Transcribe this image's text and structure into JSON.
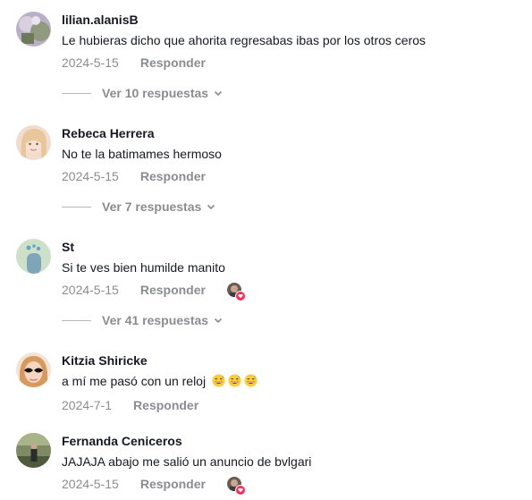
{
  "comments": [
    {
      "username": "lilian.alanisB",
      "text": "Le hubieras dicho que ahorita regresabas ibas por los otros ceros",
      "date": "2024-5-15",
      "reply_label": "Responder",
      "replies_label": "Ver 10 respuestas"
    },
    {
      "username": "Rebeca Herrera",
      "text": "No te la batimames hermoso",
      "date": "2024-5-15",
      "reply_label": "Responder",
      "replies_label": "Ver 7 respuestas"
    },
    {
      "username": "St",
      "text": "Si te ves bien humilde manito",
      "date": "2024-5-15",
      "reply_label": "Responder",
      "replies_label": "Ver 41 respuestas",
      "liked_by_creator": true
    },
    {
      "username": "Kitzia Shiricke",
      "text": "a mí me pasó con un reloj",
      "emojis": [
        "grinning-sweat-emoji",
        "grinning-sweat-emoji",
        "grinning-sweat-emoji"
      ],
      "date": "2024-7-1",
      "reply_label": "Responder"
    },
    {
      "username": "Fernanda Ceniceros",
      "text": "JAJAJA abajo me salió un anuncio de bvlgari",
      "date": "2024-5-15",
      "reply_label": "Responder",
      "liked_by_creator": true
    }
  ],
  "colors": {
    "text": "#161823",
    "muted": "rgba(22,24,35,0.5)",
    "like_heart": "#fe2c55"
  }
}
